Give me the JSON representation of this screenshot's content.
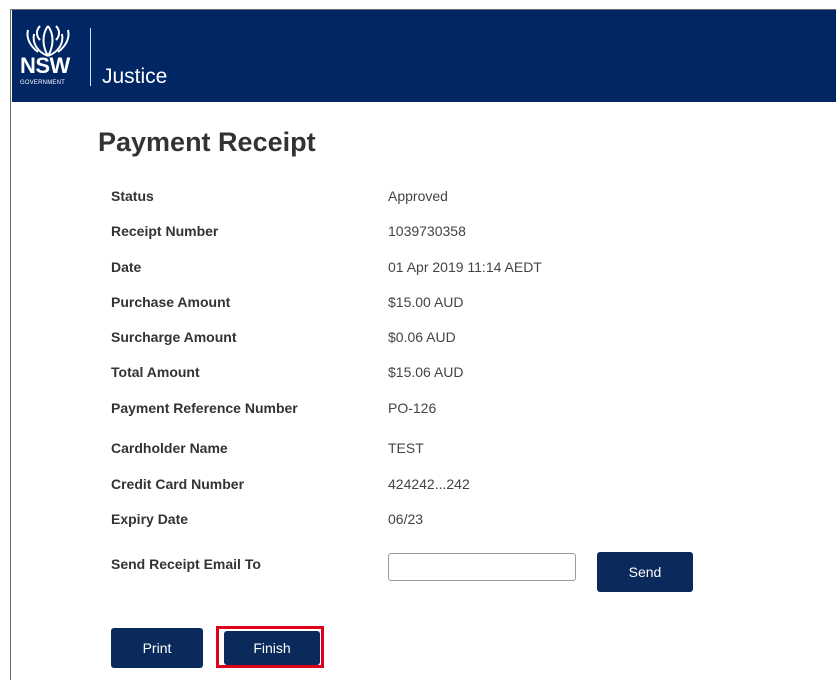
{
  "header": {
    "logo_nsw": "NSW",
    "logo_government": "GOVERNMENT",
    "department": "Justice",
    "background_color": "#002664"
  },
  "page": {
    "title": "Payment Receipt"
  },
  "receipt": {
    "rows": [
      {
        "label": "Status",
        "value": "Approved"
      },
      {
        "label": "Receipt Number",
        "value": "1039730358"
      },
      {
        "label": "Date",
        "value": "01 Apr 2019 11:14 AEDT"
      },
      {
        "label": "Purchase Amount",
        "value": "$15.00 AUD"
      },
      {
        "label": "Surcharge Amount",
        "value": "$0.06 AUD"
      },
      {
        "label": "Total Amount",
        "value": "$15.06 AUD"
      },
      {
        "label": "Payment Reference Number",
        "value": "PO-126"
      },
      {
        "label": "Cardholder Name",
        "value": "TEST"
      },
      {
        "label": "Credit Card Number",
        "value": "424242...242"
      },
      {
        "label": "Expiry Date",
        "value": "06/23"
      }
    ]
  },
  "email": {
    "label": "Send Receipt Email To",
    "value": "",
    "placeholder": "",
    "send_label": "Send"
  },
  "actions": {
    "print_label": "Print",
    "finish_label": "Finish",
    "button_color": "#0a2a5c",
    "highlight_color": "#e0001b"
  }
}
